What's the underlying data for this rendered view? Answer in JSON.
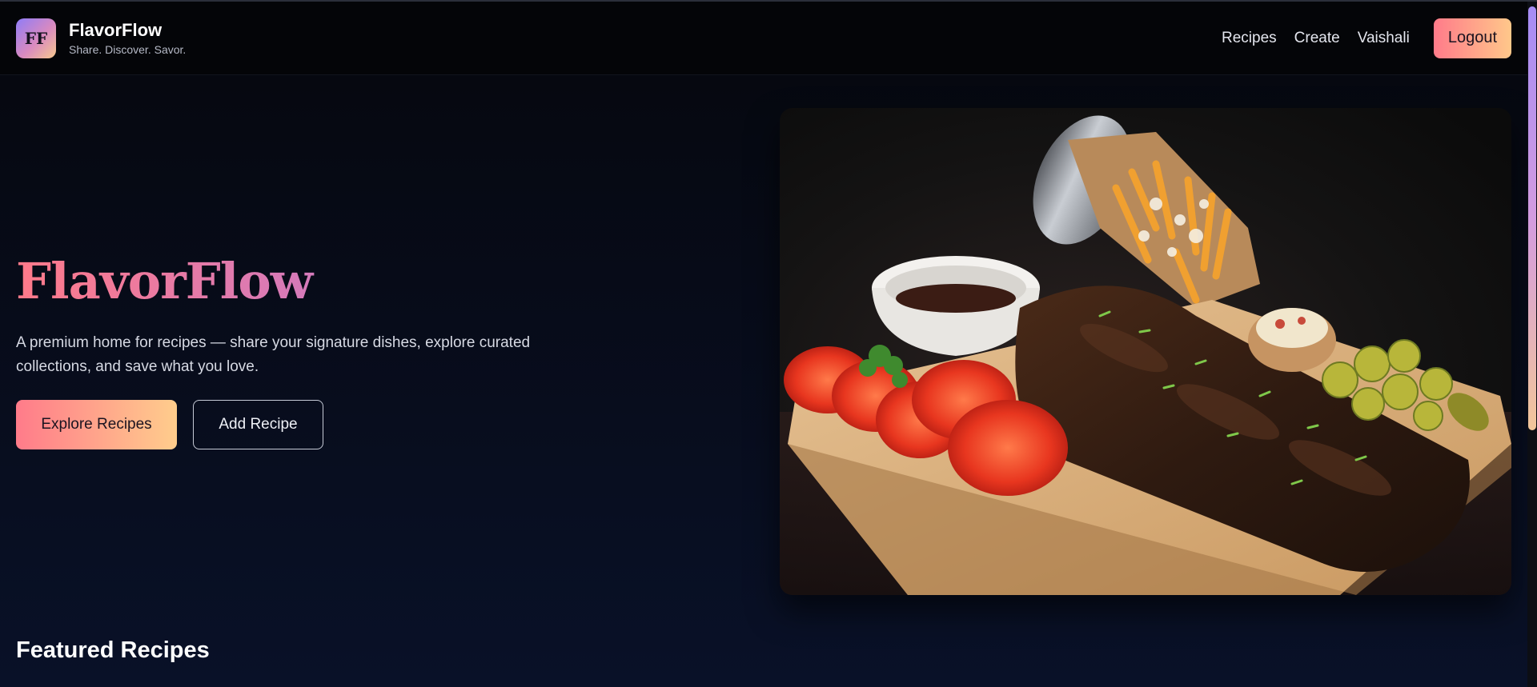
{
  "header": {
    "logo_text": "FF",
    "brand_name": "FlavorFlow",
    "tagline": "Share. Discover. Savor.",
    "nav": [
      {
        "label": "Recipes"
      },
      {
        "label": "Create"
      },
      {
        "label": "Vaishali"
      }
    ],
    "logout_label": "Logout"
  },
  "hero": {
    "title": "FlavorFlow",
    "description": "A premium home for recipes — share your signature dishes, explore curated collections, and save what you love.",
    "primary_button": "Explore Recipes",
    "secondary_button": "Add Recipe",
    "image_icon": "food-photo-icon"
  },
  "featured": {
    "title": "Featured Recipes"
  },
  "colors": {
    "accent_start": "#ff7b8a",
    "accent_end": "#ffcd8c",
    "background": "#070b18"
  }
}
